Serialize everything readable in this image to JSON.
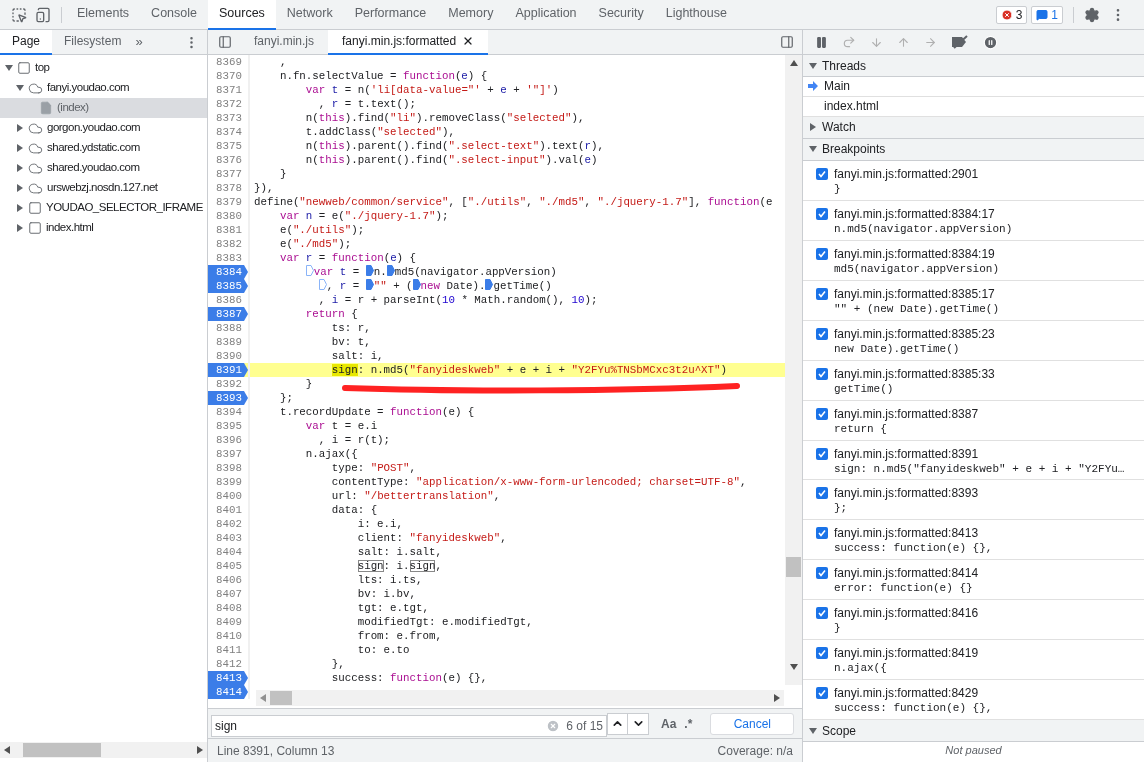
{
  "toolbar": {
    "tabs": [
      {
        "label": "Elements",
        "selected": false
      },
      {
        "label": "Console",
        "selected": false
      },
      {
        "label": "Sources",
        "selected": true
      },
      {
        "label": "Network",
        "selected": false
      },
      {
        "label": "Performance",
        "selected": false
      },
      {
        "label": "Memory",
        "selected": false
      },
      {
        "label": "Application",
        "selected": false
      },
      {
        "label": "Security",
        "selected": false
      },
      {
        "label": "Lighthouse",
        "selected": false
      }
    ],
    "errors": "3",
    "messages": "1"
  },
  "navigator": {
    "tabs": [
      {
        "label": "Page",
        "selected": true
      },
      {
        "label": "Filesystem",
        "selected": false
      }
    ],
    "more": "»",
    "tree": [
      {
        "label": "top",
        "kind": "frame",
        "expanded": true,
        "selected": false,
        "children": [
          {
            "label": "fanyi.youdao.com",
            "kind": "cloud",
            "expanded": true,
            "selected": false,
            "children": [
              {
                "label": "(index)",
                "kind": "file",
                "selected": true
              }
            ]
          },
          {
            "label": "gorgon.youdao.com",
            "kind": "cloud",
            "expanded": false,
            "selected": false
          },
          {
            "label": "shared.ydstatic.com",
            "kind": "cloud",
            "expanded": false,
            "selected": false
          },
          {
            "label": "shared.youdao.com",
            "kind": "cloud",
            "expanded": false,
            "selected": false
          },
          {
            "label": "urswebzj.nosdn.127.net",
            "kind": "cloud",
            "expanded": false,
            "selected": false
          },
          {
            "label": "YOUDAO_SELECTOR_IFRAME",
            "kind": "frame",
            "expanded": false,
            "selected": false
          },
          {
            "label": "index.html",
            "kind": "frame",
            "expanded": false,
            "selected": false
          }
        ]
      }
    ]
  },
  "editor": {
    "tabs": [
      {
        "label": "fanyi.min.js",
        "selected": false,
        "closable": false
      },
      {
        "label": "fanyi.min.js:formatted",
        "selected": true,
        "closable": true
      }
    ],
    "lines": [
      {
        "n": "8369",
        "breakpoint": false,
        "current": false,
        "tokens": [
          {
            "t": "    ,",
            "kind": "p"
          }
        ]
      },
      {
        "n": "8370",
        "breakpoint": false,
        "current": false,
        "tokens": [
          {
            "t": "    n.fn.selectValue = ",
            "kind": "p"
          },
          {
            "t": "function",
            "kind": "kw"
          },
          {
            "t": "(",
            "kind": "p"
          },
          {
            "t": "e",
            "kind": "v"
          },
          {
            "t": ") {",
            "kind": "p"
          }
        ]
      },
      {
        "n": "8371",
        "breakpoint": false,
        "current": false,
        "tokens": [
          {
            "t": "        var",
            "kind": "kw"
          },
          {
            "t": " t",
            "kind": "v"
          },
          {
            "t": " = n(",
            "kind": "p"
          },
          {
            "t": "'li[data-value=\"'",
            "kind": "str"
          },
          {
            "t": " + ",
            "kind": "p"
          },
          {
            "t": "e",
            "kind": "v"
          },
          {
            "t": " + ",
            "kind": "p"
          },
          {
            "t": "'\"]'",
            "kind": "str"
          },
          {
            "t": ")",
            "kind": "p"
          }
        ]
      },
      {
        "n": "8372",
        "breakpoint": false,
        "current": false,
        "tokens": [
          {
            "t": "          , ",
            "kind": "p"
          },
          {
            "t": "r",
            "kind": "v"
          },
          {
            "t": " = t.text();",
            "kind": "p"
          }
        ]
      },
      {
        "n": "8373",
        "breakpoint": false,
        "current": false,
        "tokens": [
          {
            "t": "        n(",
            "kind": "p"
          },
          {
            "t": "this",
            "kind": "kw"
          },
          {
            "t": ").find(",
            "kind": "p"
          },
          {
            "t": "\"li\"",
            "kind": "str"
          },
          {
            "t": ").removeClass(",
            "kind": "p"
          },
          {
            "t": "\"selected\"",
            "kind": "str"
          },
          {
            "t": "),",
            "kind": "p"
          }
        ]
      },
      {
        "n": "8374",
        "breakpoint": false,
        "current": false,
        "tokens": [
          {
            "t": "        t.addClass(",
            "kind": "p"
          },
          {
            "t": "\"selected\"",
            "kind": "str"
          },
          {
            "t": "),",
            "kind": "p"
          }
        ]
      },
      {
        "n": "8375",
        "breakpoint": false,
        "current": false,
        "tokens": [
          {
            "t": "        n(",
            "kind": "p"
          },
          {
            "t": "this",
            "kind": "kw"
          },
          {
            "t": ").parent().find(",
            "kind": "p"
          },
          {
            "t": "\".select-text\"",
            "kind": "str"
          },
          {
            "t": ").text(",
            "kind": "p"
          },
          {
            "t": "r",
            "kind": "v"
          },
          {
            "t": "),",
            "kind": "p"
          }
        ]
      },
      {
        "n": "8376",
        "breakpoint": false,
        "current": false,
        "tokens": [
          {
            "t": "        n(",
            "kind": "p"
          },
          {
            "t": "this",
            "kind": "kw"
          },
          {
            "t": ").parent().find(",
            "kind": "p"
          },
          {
            "t": "\".select-input\"",
            "kind": "str"
          },
          {
            "t": ").val(",
            "kind": "p"
          },
          {
            "t": "e",
            "kind": "v"
          },
          {
            "t": ")",
            "kind": "p"
          }
        ]
      },
      {
        "n": "8377",
        "breakpoint": false,
        "current": false,
        "tokens": [
          {
            "t": "    }",
            "kind": "p"
          }
        ]
      },
      {
        "n": "8378",
        "breakpoint": false,
        "current": false,
        "tokens": [
          {
            "t": "}),",
            "kind": "p"
          }
        ]
      },
      {
        "n": "8379",
        "breakpoint": false,
        "current": false,
        "tokens": [
          {
            "t": "define(",
            "kind": "p"
          },
          {
            "t": "\"newweb/common/service\"",
            "kind": "str"
          },
          {
            "t": ", [",
            "kind": "p"
          },
          {
            "t": "\"./utils\"",
            "kind": "str"
          },
          {
            "t": ", ",
            "kind": "p"
          },
          {
            "t": "\"./md5\"",
            "kind": "str"
          },
          {
            "t": ", ",
            "kind": "p"
          },
          {
            "t": "\"./jquery-1.7\"",
            "kind": "str"
          },
          {
            "t": "], ",
            "kind": "p"
          },
          {
            "t": "function",
            "kind": "kw"
          },
          {
            "t": "(e",
            "kind": "p"
          }
        ]
      },
      {
        "n": "8380",
        "breakpoint": false,
        "current": false,
        "tokens": [
          {
            "t": "    var",
            "kind": "kw"
          },
          {
            "t": " n",
            "kind": "v"
          },
          {
            "t": " = e(",
            "kind": "p"
          },
          {
            "t": "\"./jquery-1.7\"",
            "kind": "str"
          },
          {
            "t": ");",
            "kind": "p"
          }
        ]
      },
      {
        "n": "8381",
        "breakpoint": false,
        "current": false,
        "tokens": [
          {
            "t": "    e(",
            "kind": "p"
          },
          {
            "t": "\"./utils\"",
            "kind": "str"
          },
          {
            "t": ");",
            "kind": "p"
          }
        ]
      },
      {
        "n": "8382",
        "breakpoint": false,
        "current": false,
        "tokens": [
          {
            "t": "    e(",
            "kind": "p"
          },
          {
            "t": "\"./md5\"",
            "kind": "str"
          },
          {
            "t": ");",
            "kind": "p"
          }
        ]
      },
      {
        "n": "8383",
        "breakpoint": false,
        "current": false,
        "tokens": [
          {
            "t": "    var",
            "kind": "kw"
          },
          {
            "t": " r",
            "kind": "v"
          },
          {
            "t": " = ",
            "kind": "p"
          },
          {
            "t": "function",
            "kind": "kw"
          },
          {
            "t": "(",
            "kind": "p"
          },
          {
            "t": "e",
            "kind": "v"
          },
          {
            "t": ") {",
            "kind": "p"
          }
        ]
      },
      {
        "n": "8384",
        "breakpoint": true,
        "current": false,
        "tokens": [
          {
            "t": "        var",
            "kind": "kw",
            "marker": false
          },
          {
            "t": " t",
            "kind": "v"
          },
          {
            "t": " = ",
            "kind": "p"
          },
          {
            "t": "n.",
            "kind": "p",
            "marker": true
          },
          {
            "t": "md5(navigator.appVersion)",
            "kind": "p",
            "marker": true
          }
        ]
      },
      {
        "n": "8385",
        "breakpoint": true,
        "current": false,
        "tokens": [
          {
            "t": "          , ",
            "kind": "p",
            "marker": false
          },
          {
            "t": "r",
            "kind": "v"
          },
          {
            "t": " = ",
            "kind": "p"
          },
          {
            "t": "\"\"",
            "kind": "str",
            "marker": true
          },
          {
            "t": " + (",
            "kind": "p"
          },
          {
            "t": "new",
            "kind": "kw",
            "marker": true
          },
          {
            "t": " Date).",
            "kind": "p"
          },
          {
            "t": "getTime()",
            "kind": "p",
            "marker": true
          }
        ]
      },
      {
        "n": "8386",
        "breakpoint": false,
        "current": false,
        "tokens": [
          {
            "t": "          , ",
            "kind": "p"
          },
          {
            "t": "i",
            "kind": "v"
          },
          {
            "t": " = r + parseInt(",
            "kind": "p"
          },
          {
            "t": "10",
            "kind": "num"
          },
          {
            "t": " * Math.random(), ",
            "kind": "p"
          },
          {
            "t": "10",
            "kind": "num"
          },
          {
            "t": ");",
            "kind": "p"
          }
        ]
      },
      {
        "n": "8387",
        "breakpoint": true,
        "current": false,
        "tokens": [
          {
            "t": "        return",
            "kind": "kw"
          },
          {
            "t": " {",
            "kind": "p"
          }
        ]
      },
      {
        "n": "8388",
        "breakpoint": false,
        "current": false,
        "tokens": [
          {
            "t": "            ts: r,",
            "kind": "p"
          }
        ]
      },
      {
        "n": "8389",
        "breakpoint": false,
        "current": false,
        "tokens": [
          {
            "t": "            bv: t,",
            "kind": "p"
          }
        ]
      },
      {
        "n": "8390",
        "breakpoint": false,
        "current": false,
        "tokens": [
          {
            "t": "            salt: i,",
            "kind": "p"
          }
        ]
      },
      {
        "n": "8391",
        "breakpoint": true,
        "current": true,
        "tokens": [
          {
            "t": "            sign",
            "kind": "match"
          },
          {
            "t": ": n.md5(",
            "kind": "p"
          },
          {
            "t": "\"fanyideskweb\"",
            "kind": "str"
          },
          {
            "t": " + e + i + ",
            "kind": "p"
          },
          {
            "t": "\"Y2FYu%TNSbMCxc3t2u^XT\"",
            "kind": "str"
          },
          {
            "t": ")",
            "kind": "p"
          }
        ]
      },
      {
        "n": "8392",
        "breakpoint": false,
        "current": false,
        "tokens": [
          {
            "t": "        }",
            "kind": "p"
          }
        ]
      },
      {
        "n": "8393",
        "breakpoint": true,
        "current": false,
        "tokens": [
          {
            "t": "    };",
            "kind": "p"
          }
        ]
      },
      {
        "n": "8394",
        "breakpoint": false,
        "current": false,
        "tokens": [
          {
            "t": "    t.recordUpdate = ",
            "kind": "p"
          },
          {
            "t": "function",
            "kind": "kw"
          },
          {
            "t": "(e) {",
            "kind": "p"
          }
        ]
      },
      {
        "n": "8395",
        "breakpoint": false,
        "current": false,
        "tokens": [
          {
            "t": "        var",
            "kind": "kw"
          },
          {
            "t": " t = e.i",
            "kind": "p"
          }
        ]
      },
      {
        "n": "8396",
        "breakpoint": false,
        "current": false,
        "tokens": [
          {
            "t": "          , i = r(t);",
            "kind": "p"
          }
        ]
      },
      {
        "n": "8397",
        "breakpoint": false,
        "current": false,
        "tokens": [
          {
            "t": "        n.ajax({",
            "kind": "p"
          }
        ]
      },
      {
        "n": "8398",
        "breakpoint": false,
        "current": false,
        "tokens": [
          {
            "t": "            type: ",
            "kind": "p"
          },
          {
            "t": "\"POST\"",
            "kind": "str"
          },
          {
            "t": ",",
            "kind": "p"
          }
        ]
      },
      {
        "n": "8399",
        "breakpoint": false,
        "current": false,
        "tokens": [
          {
            "t": "            contentType: ",
            "kind": "p"
          },
          {
            "t": "\"application/x-www-form-urlencoded; charset=UTF-8\"",
            "kind": "str"
          },
          {
            "t": ",",
            "kind": "p"
          }
        ]
      },
      {
        "n": "8400",
        "breakpoint": false,
        "current": false,
        "tokens": [
          {
            "t": "            url: ",
            "kind": "p"
          },
          {
            "t": "\"/bettertranslation\"",
            "kind": "str"
          },
          {
            "t": ",",
            "kind": "p"
          }
        ]
      },
      {
        "n": "8401",
        "breakpoint": false,
        "current": false,
        "tokens": [
          {
            "t": "            data: {",
            "kind": "p"
          }
        ]
      },
      {
        "n": "8402",
        "breakpoint": false,
        "current": false,
        "tokens": [
          {
            "t": "                i: e.i,",
            "kind": "p"
          }
        ]
      },
      {
        "n": "8403",
        "breakpoint": false,
        "current": false,
        "tokens": [
          {
            "t": "                client: ",
            "kind": "p"
          },
          {
            "t": "\"fanyideskweb\"",
            "kind": "str"
          },
          {
            "t": ",",
            "kind": "p"
          }
        ]
      },
      {
        "n": "8404",
        "breakpoint": false,
        "current": false,
        "tokens": [
          {
            "t": "                salt: i.salt,",
            "kind": "p"
          }
        ]
      },
      {
        "n": "8405",
        "breakpoint": false,
        "current": false,
        "tokens": [
          {
            "t": "                sign",
            "kind": "hit"
          },
          {
            "t": ": i.",
            "kind": "p"
          },
          {
            "t": "sign",
            "kind": "hit"
          },
          {
            "t": ",",
            "kind": "p"
          }
        ]
      },
      {
        "n": "8406",
        "breakpoint": false,
        "current": false,
        "tokens": [
          {
            "t": "                lts: i.ts,",
            "kind": "p"
          }
        ]
      },
      {
        "n": "8407",
        "breakpoint": false,
        "current": false,
        "tokens": [
          {
            "t": "                bv: i.bv,",
            "kind": "p"
          }
        ]
      },
      {
        "n": "8408",
        "breakpoint": false,
        "current": false,
        "tokens": [
          {
            "t": "                tgt: e.tgt,",
            "kind": "p"
          }
        ]
      },
      {
        "n": "8409",
        "breakpoint": false,
        "current": false,
        "tokens": [
          {
            "t": "                modifiedTgt: e.modifiedTgt,",
            "kind": "p"
          }
        ]
      },
      {
        "n": "8410",
        "breakpoint": false,
        "current": false,
        "tokens": [
          {
            "t": "                from: e.from,",
            "kind": "p"
          }
        ]
      },
      {
        "n": "8411",
        "breakpoint": false,
        "current": false,
        "tokens": [
          {
            "t": "                to: e.to",
            "kind": "p"
          }
        ]
      },
      {
        "n": "8412",
        "breakpoint": false,
        "current": false,
        "tokens": [
          {
            "t": "            },",
            "kind": "p"
          }
        ]
      },
      {
        "n": "8413",
        "breakpoint": true,
        "current": false,
        "tokens": [
          {
            "t": "            success: ",
            "kind": "p"
          },
          {
            "t": "function",
            "kind": "kw"
          },
          {
            "t": "(e) {},",
            "kind": "p"
          }
        ]
      },
      {
        "n": "8414",
        "breakpoint": true,
        "current": false
      }
    ],
    "search": {
      "value": "sign",
      "count": "6 of 15",
      "case_label": "Aa",
      "regex_label": ".*",
      "cancel": "Cancel"
    },
    "status": {
      "position": "Line 8391, Column 13",
      "coverage": "Coverage: n/a"
    }
  },
  "debugger": {
    "sections": [
      {
        "kind": "threads",
        "title": "Threads",
        "expanded": true,
        "items": [
          {
            "label": "Main",
            "selected": true
          },
          {
            "label": "index.html",
            "selected": false
          }
        ]
      },
      {
        "kind": "watch",
        "title": "Watch",
        "expanded": false
      },
      {
        "kind": "breakpoints",
        "title": "Breakpoints",
        "expanded": true,
        "items": [
          {
            "checked": true,
            "location": "fanyi.min.js:formatted:2901",
            "code": "}"
          },
          {
            "checked": true,
            "location": "fanyi.min.js:formatted:8384:17",
            "code": "n.md5(navigator.appVersion)"
          },
          {
            "checked": true,
            "location": "fanyi.min.js:formatted:8384:19",
            "code": "md5(navigator.appVersion)"
          },
          {
            "checked": true,
            "location": "fanyi.min.js:formatted:8385:17",
            "code": "\"\" + (new Date).getTime()"
          },
          {
            "checked": true,
            "location": "fanyi.min.js:formatted:8385:23",
            "code": "new Date).getTime()"
          },
          {
            "checked": true,
            "location": "fanyi.min.js:formatted:8385:33",
            "code": "getTime()"
          },
          {
            "checked": true,
            "location": "fanyi.min.js:formatted:8387",
            "code": "return {"
          },
          {
            "checked": true,
            "location": "fanyi.min.js:formatted:8391",
            "code": "sign: n.md5(\"fanyideskweb\" + e + i + \"Y2FYu…"
          },
          {
            "checked": true,
            "location": "fanyi.min.js:formatted:8393",
            "code": "};"
          },
          {
            "checked": true,
            "location": "fanyi.min.js:formatted:8413",
            "code": "success: function(e) {},"
          },
          {
            "checked": true,
            "location": "fanyi.min.js:formatted:8414",
            "code": "error: function(e) {}"
          },
          {
            "checked": true,
            "location": "fanyi.min.js:formatted:8416",
            "code": "}"
          },
          {
            "checked": true,
            "location": "fanyi.min.js:formatted:8419",
            "code": "n.ajax({"
          },
          {
            "checked": true,
            "location": "fanyi.min.js:formatted:8429",
            "code": "success: function(e) {},"
          }
        ]
      },
      {
        "kind": "scope",
        "title": "Scope",
        "expanded": true,
        "message": "Not paused"
      }
    ]
  }
}
